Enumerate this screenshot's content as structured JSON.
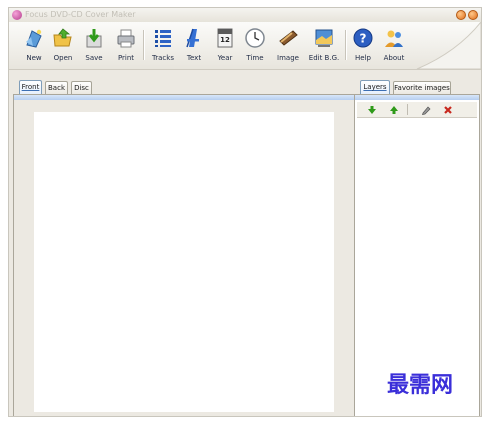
{
  "window": {
    "title": "Focus DVD-CD Cover Maker"
  },
  "toolbar": {
    "buttons": [
      {
        "label": "New",
        "icon": "new-file-icon"
      },
      {
        "label": "Open",
        "icon": "open-folder-icon"
      },
      {
        "label": "Save",
        "icon": "save-icon"
      },
      {
        "label": "Print",
        "icon": "printer-icon"
      },
      {
        "label": "Tracks",
        "icon": "tracks-list-icon"
      },
      {
        "label": "Text",
        "icon": "text-a-icon"
      },
      {
        "label": "Year",
        "icon": "calendar-icon",
        "badge": "12"
      },
      {
        "label": "Time",
        "icon": "clock-icon"
      },
      {
        "label": "Image",
        "icon": "image-icon"
      },
      {
        "label": "Edit B.G.",
        "icon": "edit-background-icon"
      },
      {
        "label": "Help",
        "icon": "help-icon"
      },
      {
        "label": "About",
        "icon": "about-users-icon"
      }
    ]
  },
  "left_tabs": [
    {
      "label": "Front",
      "active": true
    },
    {
      "label": "Back",
      "active": false
    },
    {
      "label": "Disc",
      "active": false
    }
  ],
  "right_tabs": [
    {
      "label": "Layers",
      "active": true
    },
    {
      "label": "Favorite images",
      "active": false
    }
  ],
  "layer_tools": [
    {
      "icon": "move-down-arrow-icon"
    },
    {
      "icon": "move-up-arrow-icon"
    },
    {
      "icon": "edit-pencil-icon"
    },
    {
      "icon": "delete-x-icon"
    }
  ],
  "watermark": "最需网",
  "colors": {
    "accent_blue": "#3c6fb4",
    "tab_strip": "#c6dbf6",
    "watermark": "#3b2fd9",
    "arrow_green": "#2f9a1a",
    "delete_red": "#c8281e"
  }
}
